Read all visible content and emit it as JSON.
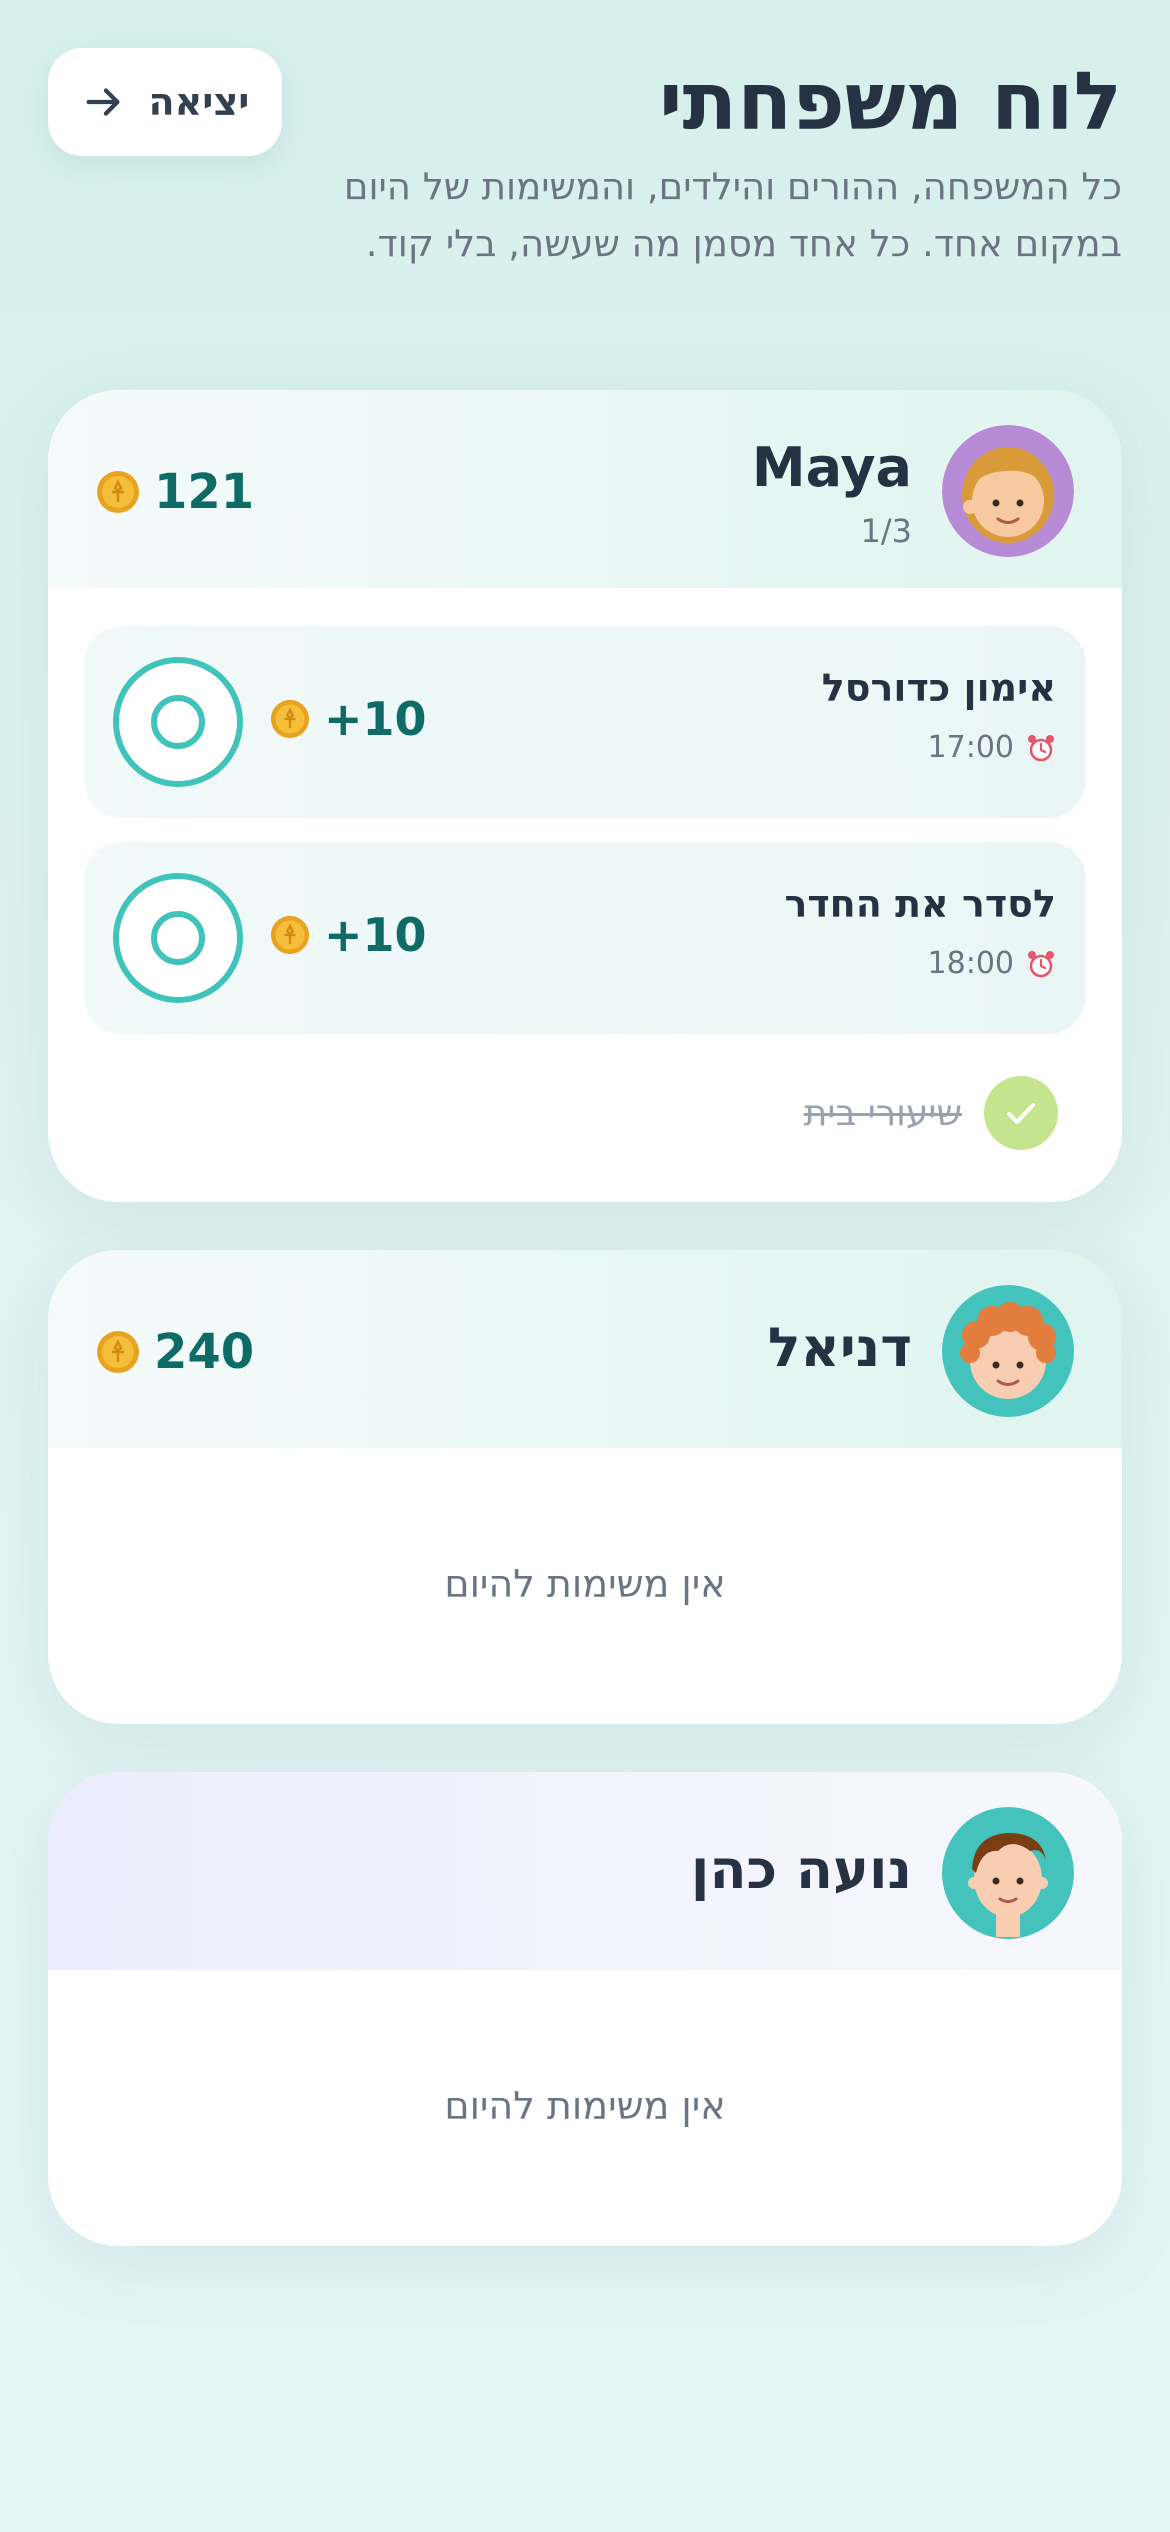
{
  "header": {
    "title": "לוח משפחתי",
    "subtitle": "כל המשפחה, ההורים והילדים, והמשימות של היום במקום אחד. כל אחד מסמן מה שעשה, בלי קוד.",
    "exit_label": "יציאה"
  },
  "members": [
    {
      "name": "Maya",
      "progress": "1/3",
      "points": "121",
      "tasks": [
        {
          "title": "אימון כדורסל",
          "time": "17:00",
          "points": "+10"
        },
        {
          "title": "לסדר את החדר",
          "time": "18:00",
          "points": "+10"
        }
      ],
      "done_tasks": [
        {
          "title": "שיעורי בית"
        }
      ]
    },
    {
      "name": "דניאל",
      "points": "240",
      "empty_text": "אין משימות להיום"
    },
    {
      "name": "נועה כהן",
      "empty_text": "אין משימות להיום"
    }
  ],
  "colors": {
    "accent_teal": "#40c3ba",
    "points_text": "#0f6b65",
    "done_green": "#c4e48d",
    "coin_gold": "#f0b02a"
  },
  "icons": [
    "arrow-right-icon",
    "coin-icon",
    "alarm-clock-icon",
    "check-icon",
    "avatar-girl",
    "avatar-boy-curly",
    "avatar-boy"
  ]
}
